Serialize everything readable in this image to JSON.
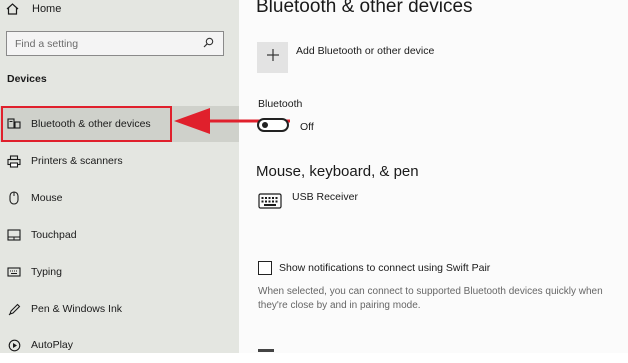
{
  "sidebar": {
    "home_label": "Home",
    "search_placeholder": "Find a setting",
    "section_title": "Devices",
    "items": [
      {
        "label": "Bluetooth & other devices",
        "icon": "bluetooth-devices-icon",
        "active": true
      },
      {
        "label": "Printers & scanners",
        "icon": "printer-icon"
      },
      {
        "label": "Mouse",
        "icon": "mouse-icon"
      },
      {
        "label": "Touchpad",
        "icon": "touchpad-icon"
      },
      {
        "label": "Typing",
        "icon": "keyboard-icon"
      },
      {
        "label": "Pen & Windows Ink",
        "icon": "pen-icon"
      },
      {
        "label": "AutoPlay",
        "icon": "autoplay-icon"
      }
    ]
  },
  "main": {
    "title": "Bluetooth & other devices",
    "add_device_label": "Add Bluetooth or other device",
    "bluetooth_label": "Bluetooth",
    "bluetooth_state": "Off",
    "mouse_section_title": "Mouse, keyboard, & pen",
    "device_name": "USB Receiver",
    "swift_pair_label": "Show notifications to connect using Swift Pair",
    "swift_pair_description": "When selected, you can connect to supported Bluetooth devices quickly when they're close by and in pairing mode."
  },
  "colors": {
    "highlight": "#e0202c",
    "sidebar_bg": "#e4e6e1",
    "active_bg": "#cfd1cb"
  }
}
